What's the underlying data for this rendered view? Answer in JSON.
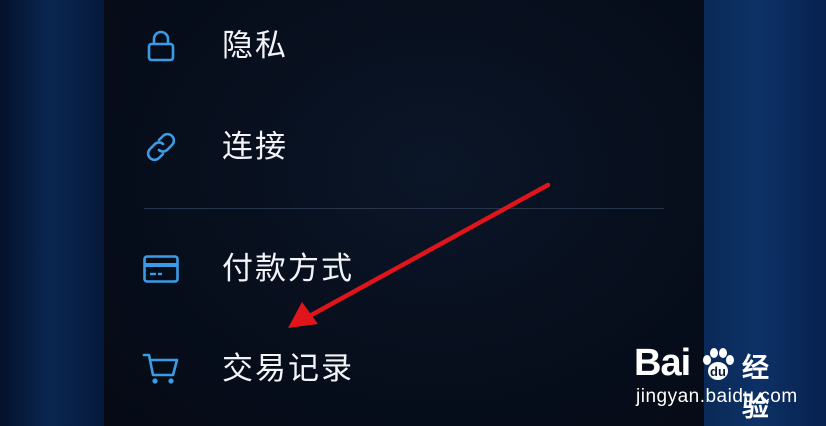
{
  "menu": {
    "items": [
      {
        "label": "隐私",
        "icon": "lock-icon"
      },
      {
        "label": "连接",
        "icon": "link-icon"
      },
      {
        "label": "付款方式",
        "icon": "credit-card-icon"
      },
      {
        "label": "交易记录",
        "icon": "cart-icon"
      }
    ]
  },
  "colors": {
    "icon_accent": "#3a9be6",
    "label_text": "#f2f4f8",
    "arrow": "#e0151b",
    "panel_bg": "#070e1c"
  },
  "watermark": {
    "brand": "Bai",
    "brand_du": "du",
    "product": "经验",
    "url": "jingyan.baidu.com"
  }
}
